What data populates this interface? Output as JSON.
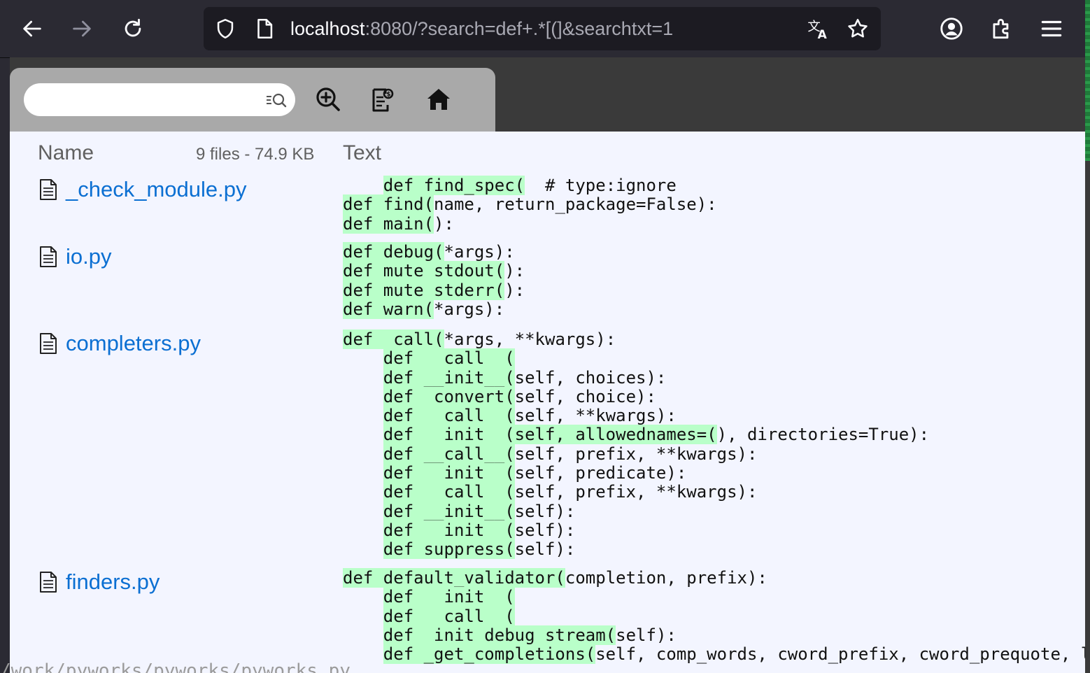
{
  "browser": {
    "url_host": "localhost",
    "url_rest": ":8080/?search=def+.*[(]&searchtxt=1"
  },
  "toolbar": {
    "search_value": "",
    "search_placeholder": ""
  },
  "header": {
    "name_label": "Name",
    "file_count": "9 files - 74.9 KB",
    "text_label": "Text"
  },
  "files": [
    {
      "name": "_check_module.py",
      "lines": [
        {
          "pre": "    ",
          "match": "def find_spec(",
          "post": "  # type:ignore"
        },
        {
          "pre": "",
          "match": "def find(",
          "post": "name, return_package=False):"
        },
        {
          "pre": "",
          "match": "def main(",
          "post": "):"
        }
      ]
    },
    {
      "name": "io.py",
      "lines": [
        {
          "pre": "",
          "match": "def debug(",
          "post": "*args):"
        },
        {
          "pre": "",
          "match": "def mute stdout(",
          "post": "):"
        },
        {
          "pre": "",
          "match": "def mute stderr(",
          "post": "):"
        },
        {
          "pre": "",
          "match": "def warn(",
          "post": "*args):"
        }
      ]
    },
    {
      "name": "completers.py",
      "lines": [
        {
          "pre": "",
          "match": "def  call(",
          "post": "*args, **kwargs):"
        },
        {
          "pre": "    ",
          "match": "def   call  (",
          "post": ""
        },
        {
          "pre": "    ",
          "match": "def __init__(",
          "post": "self, choices):"
        },
        {
          "pre": "    ",
          "match": "def  convert(",
          "post": "self, choice):"
        },
        {
          "pre": "    ",
          "match": "def   call  (",
          "post": "self, **kwargs):"
        },
        {
          "pre": "    ",
          "match": "def   init  (self, allowednames=(",
          "post": "), directories=True):"
        },
        {
          "pre": "    ",
          "match": "def __call__(",
          "post": "self, prefix, **kwargs):"
        },
        {
          "pre": "    ",
          "match": "def   init  (",
          "post": "self, predicate):"
        },
        {
          "pre": "    ",
          "match": "def   call  (",
          "post": "self, prefix, **kwargs):"
        },
        {
          "pre": "    ",
          "match": "def __init__(",
          "post": "self):"
        },
        {
          "pre": "    ",
          "match": "def   init  (",
          "post": "self):"
        },
        {
          "pre": "    ",
          "match": "def suppress(",
          "post": "self):"
        }
      ]
    },
    {
      "name": "finders.py",
      "lines": [
        {
          "pre": "",
          "match": "def default_validator(",
          "post": "completion, prefix):"
        },
        {
          "pre": "    ",
          "match": "def   init  (",
          "post": ""
        },
        {
          "pre": "    ",
          "match": "def   call  (",
          "post": ""
        },
        {
          "pre": "    ",
          "match": "def  init debug stream(",
          "post": "self):"
        },
        {
          "pre": "    ",
          "match": "def _get_completions(",
          "post": "self, comp_words, cword_prefix, cword_prequote, l"
        }
      ]
    }
  ],
  "ghost_text": "/work/pyworks/pyworks/pyworks.py",
  "colors": {
    "highlight": "#b9ffc9",
    "link": "#0b6fd2",
    "toolbar": "#a9a9a9",
    "content_bg": "#f3f5ff",
    "chrome_bg": "#2b2a33"
  }
}
